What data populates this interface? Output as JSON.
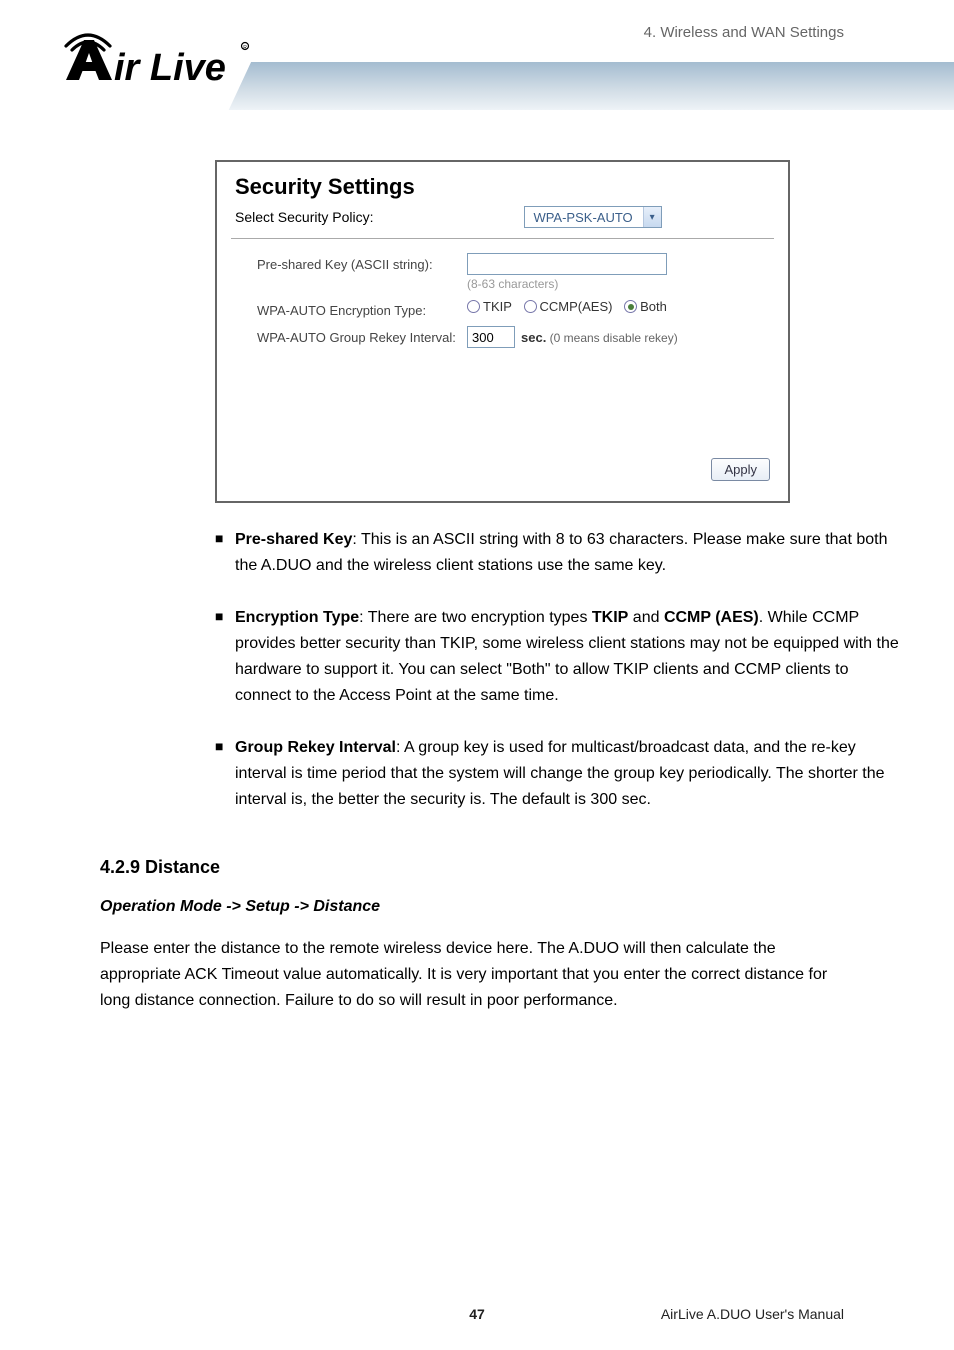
{
  "header": {
    "section_label": "4. Wireless and WAN Settings",
    "logo_text": "Air Live"
  },
  "panel": {
    "title": "Security Settings",
    "policy_label": "Select Security Policy:",
    "policy_value": "WPA-PSK-AUTO",
    "psk_label": "Pre-shared Key (ASCII string):",
    "psk_value": "",
    "psk_hint": "(8-63 characters)",
    "enc_label": "WPA-AUTO Encryption Type:",
    "enc_opts": {
      "tkip": "TKIP",
      "ccmp": "CCMP(AES)",
      "both": "Both"
    },
    "rekey_label": "WPA-AUTO Group Rekey Interval:",
    "rekey_value": "300",
    "rekey_unit_bold": "sec.",
    "rekey_unit_rest": " (0 means disable rekey)",
    "apply": "Apply"
  },
  "bullets": {
    "b1_lead": "Pre-shared Key",
    "b1_rest": ": This is an ASCII string with 8 to 63 characters. Please make sure that both the A.DUO and the wireless client stations use the same key.",
    "b2_lead": "Encryption Type",
    "b2_mid1": ": There are two encryption types ",
    "b2_tkip": "TKIP",
    "b2_mid2": " and ",
    "b2_ccmp": "CCMP (AES)",
    "b2_rest": ". While CCMP provides better security than TKIP, some wireless client stations may not be equipped with the hardware to support it. You can select \"Both\" to allow TKIP clients and CCMP clients to connect to the Access Point at the same time.",
    "b3_lead": "Group Rekey Interval",
    "b3_rest": ": A group key is used for multicast/broadcast data, and the re-key interval is time period that the system will change the group key periodically. The shorter the interval is, the better the security is. The default is 300 sec."
  },
  "sections": {
    "distance_heading": "4.2.9 Distance",
    "distance_sub": "Operation Mode -> Setup -> Distance",
    "distance_body": "Please enter the distance to the remote wireless device here. The A.DUO will then calculate the appropriate ACK Timeout value automatically. It is very important that you enter the correct distance for long distance connection. Failure to do so will result in poor performance."
  },
  "footer": {
    "page": "47",
    "manual": "AirLive A.DUO User's Manual"
  }
}
